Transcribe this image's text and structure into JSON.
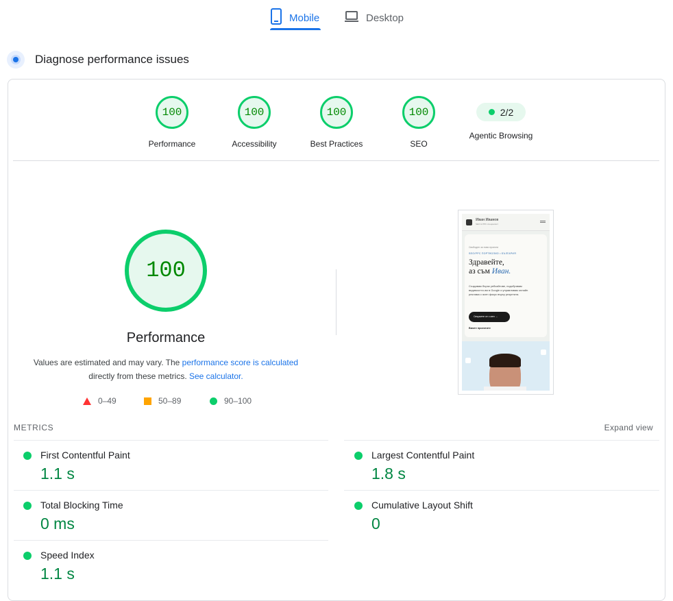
{
  "tabs": [
    {
      "label": "Mobile",
      "icon": "phone-icon",
      "active": true
    },
    {
      "label": "Desktop",
      "icon": "laptop-icon",
      "active": false
    }
  ],
  "section": {
    "title": "Diagnose performance issues"
  },
  "scores": [
    {
      "value": "100",
      "label": "Performance"
    },
    {
      "value": "100",
      "label": "Accessibility"
    },
    {
      "value": "100",
      "label": "Best Practices"
    },
    {
      "value": "100",
      "label": "SEO"
    }
  ],
  "agentic": {
    "value": "2/2",
    "label": "Agentic Browsing"
  },
  "main_score": {
    "value": "100",
    "title": "Performance"
  },
  "note": {
    "part1": "Values are estimated and may vary. The ",
    "link1": "performance score is calculated",
    "part2": "directly from these metrics. ",
    "link2": "See calculator."
  },
  "legend": [
    {
      "label": "0–49",
      "shape": "triangle",
      "color": "#ff3333"
    },
    {
      "label": "50–89",
      "shape": "square",
      "color": "#ffa400"
    },
    {
      "label": "90–100",
      "shape": "circle",
      "color": "#0cce6b"
    }
  ],
  "thumbnail": {
    "site_name": "Иван Иванов",
    "site_sub": "SEO & PPC специалист",
    "status": "Свободен за нови проекти",
    "tag": "SEO/PPC ПОРТФОЛИО • БЪЛГАРИЯ",
    "heading_line1": "Здравейте,",
    "heading_line2_prefix": "аз съм ",
    "heading_name": "Иван.",
    "paragraph": "Създавам бързи уебсайтове, подобрявам видимостта им в Google и управлявам онлайн реклама с ясен фокус върху резултата.",
    "button": "Свържете се с мен →",
    "link": "Вижте проектите"
  },
  "metrics_section": {
    "title": "METRICS",
    "expand": "Expand view"
  },
  "metrics": [
    {
      "name": "First Contentful Paint",
      "value": "1.1 s"
    },
    {
      "name": "Largest Contentful Paint",
      "value": "1.8 s"
    },
    {
      "name": "Total Blocking Time",
      "value": "0 ms"
    },
    {
      "name": "Cumulative Layout Shift",
      "value": "0"
    },
    {
      "name": "Speed Index",
      "value": "1.1 s"
    }
  ],
  "colors": {
    "accent": "#1a73e8",
    "pass": "#0cce6b",
    "pass_text": "#018642"
  }
}
